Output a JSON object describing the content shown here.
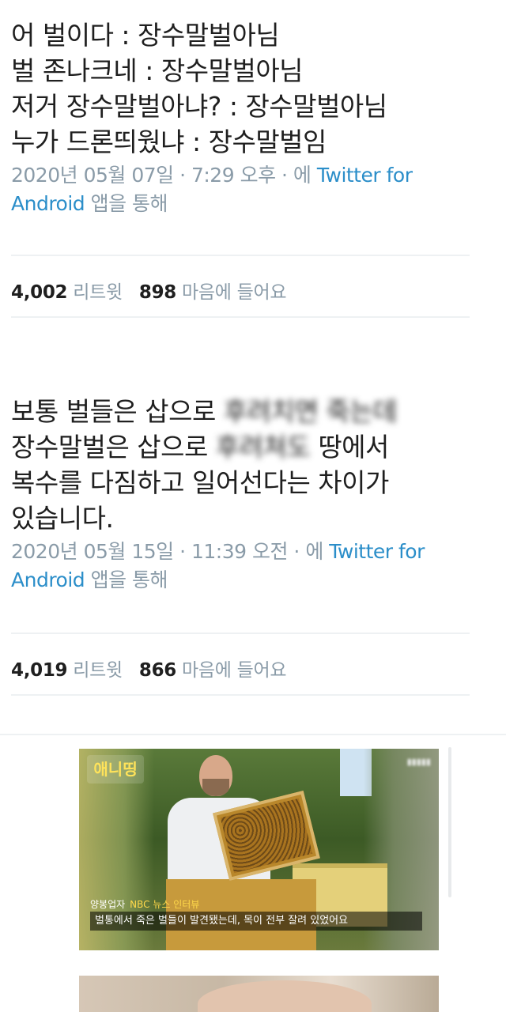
{
  "tweets": [
    {
      "lines": [
        "어 벌이다 : 장수말벌아님",
        "벌 존나크네 : 장수말벌아님",
        "저거 장수말벌아냐? : 장수말벌아님",
        "누가 드론띄웠냐 : 장수말벌임"
      ],
      "meta_date": "2020년 05월 07일 · 7:29 오후 · 에 ",
      "meta_link": "Twitter for Android",
      "meta_suffix": " 앱을 통해",
      "retweets_num": "4,002",
      "retweets_label": "리트윗",
      "likes_num": "898",
      "likes_label": "마음에 들어요"
    },
    {
      "line1_a": "보통 벌들은 삽으로 ",
      "line1_b": "후려치면 죽는데",
      "line2_a": "장수말벌은 삽으로 ",
      "line2_b": "후려쳐도",
      "line2_c": " 땅에서",
      "line3": "복수를 다짐하고 일어선다는 차이가",
      "line4": "있습니다.",
      "meta_date": "2020년 05월 15일 · 11:39 오전 · 에 ",
      "meta_link": "Twitter for Android",
      "meta_suffix": " 앱을 통해",
      "retweets_num": "4,019",
      "retweets_label": "리트윗",
      "likes_num": "866",
      "likes_label": "마음에 들어요"
    }
  ],
  "video": {
    "logo": "애니띵",
    "speaker": "양봉업자",
    "source": "NBC 뉴스 인터뷰",
    "caption": "벌통에서 죽은 벌들이 발견됐는데, 목이 전부 잘려 있었어요"
  },
  "colors": {
    "text": "#1f1f1f",
    "meta": "#8a9ba8",
    "link": "#2b8ec9",
    "divider": "#eef1f3"
  }
}
